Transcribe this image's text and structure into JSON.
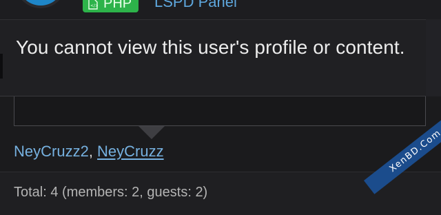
{
  "header": {
    "badge_label": "PHP",
    "badge_icon": "php-file-icon",
    "badge_color": "#2db34a",
    "link_text": "LSPD Panel",
    "link_color": "#5ea7dd",
    "avatar_color": "#1e86c8"
  },
  "tooltip": {
    "message": "You cannot view this user's profile or content."
  },
  "online": {
    "users": [
      {
        "name": "NeyCruzz2"
      },
      {
        "name": "NeyCruzz"
      }
    ],
    "separator": ", ",
    "link_color": "#76b1e0"
  },
  "footer": {
    "total_text": "Total: 4 (members: 2, guests: 2)"
  },
  "watermark": {
    "text": "XenBD.Com"
  }
}
